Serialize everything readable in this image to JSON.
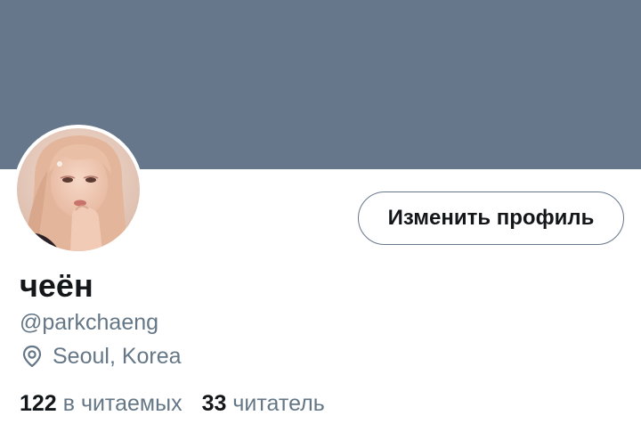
{
  "profile": {
    "display_name": "чеён",
    "handle": "@parkchaeng",
    "location": "Seoul, Korea",
    "location_icon": "map-pin-icon",
    "edit_button_label": "Изменить профиль"
  },
  "stats": {
    "following_count": "122",
    "following_label": "в читаемых",
    "followers_count": "33",
    "followers_label": "читатель"
  },
  "colors": {
    "banner": "#66778c",
    "text_primary": "#14171a",
    "text_secondary": "#657786",
    "button_border": "#66778c",
    "background": "#ffffff"
  }
}
